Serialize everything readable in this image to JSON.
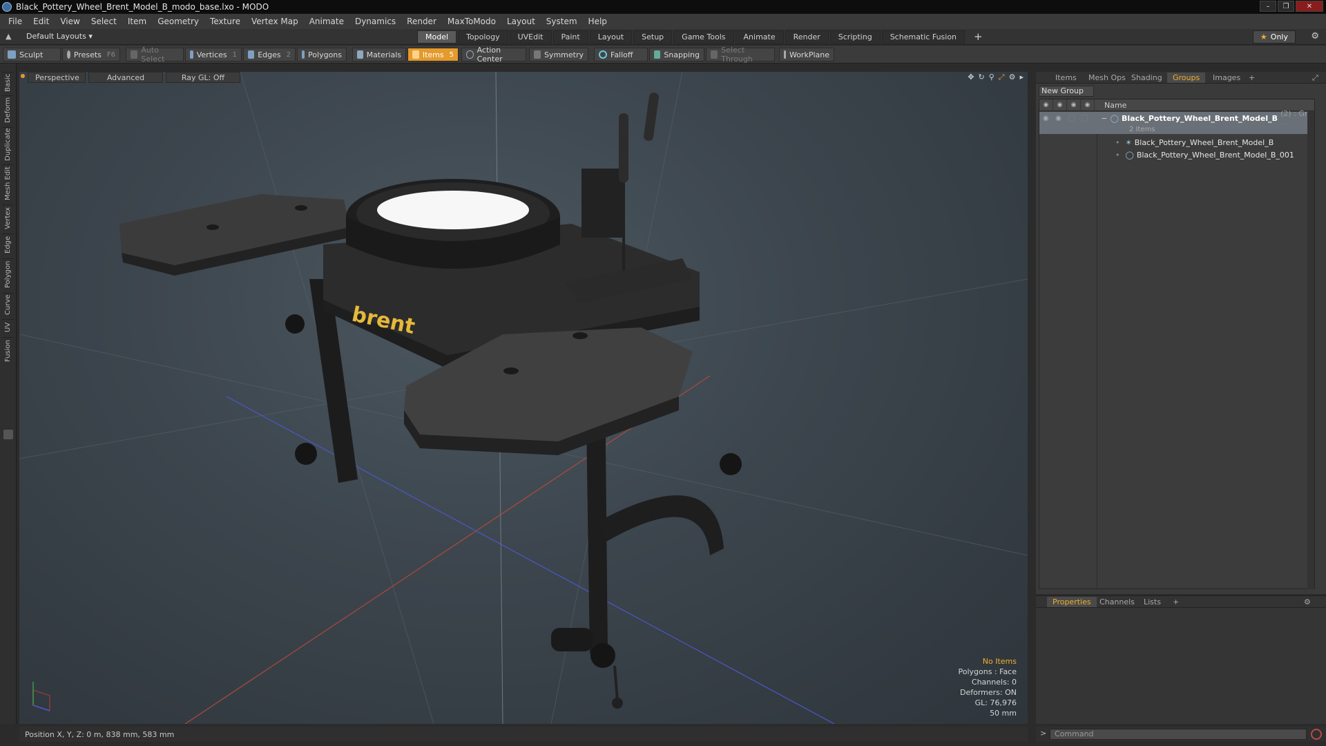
{
  "window": {
    "title": "Black_Pottery_Wheel_Brent_Model_B_modo_base.lxo - MODO"
  },
  "menu": [
    "File",
    "Edit",
    "View",
    "Select",
    "Item",
    "Geometry",
    "Texture",
    "Vertex Map",
    "Animate",
    "Dynamics",
    "Render",
    "MaxToModo",
    "Layout",
    "System",
    "Help"
  ],
  "layoutbar": {
    "layout_dropdown": "Default Layouts",
    "tabs": [
      "Model",
      "Topology",
      "UVEdit",
      "Paint",
      "Layout",
      "Setup",
      "Game Tools",
      "Animate",
      "Render",
      "Scripting",
      "Schematic Fusion"
    ],
    "active_tab": "Model",
    "only_label": "Only"
  },
  "toolbar": {
    "sculpt": "Sculpt",
    "presets": "Presets",
    "presets_key": "F6",
    "auto_select": "Auto Select",
    "vertices": "Vertices",
    "vertices_key": "1",
    "edges": "Edges",
    "edges_key": "2",
    "polygons": "Polygons",
    "materials": "Materials",
    "items": "Items",
    "items_key": "5",
    "action_center": "Action Center",
    "symmetry": "Symmetry",
    "falloff": "Falloff",
    "snapping": "Snapping",
    "select_through": "Select Through",
    "workplane": "WorkPlane"
  },
  "left_tabs": [
    "Basic",
    "Deform",
    "Duplicate",
    "Mesh Edit",
    "Vertex",
    "Edge",
    "Polygon",
    "Curve",
    "UV",
    "Fusion"
  ],
  "viewport": {
    "view_mode": "Perspective",
    "shading": "Advanced",
    "raygl": "Ray GL: Off",
    "logo_text": "brent",
    "info": {
      "no_items": "No Items",
      "polygons": "Polygons : Face",
      "channels": "Channels: 0",
      "deformers": "Deformers: ON",
      "gl": "GL: 76,976",
      "scale": "50 mm"
    }
  },
  "right_panel": {
    "tabs": [
      "Items",
      "Mesh Ops",
      "Shading",
      "Groups",
      "Images"
    ],
    "active_tab": "Groups",
    "new_group": "New Group",
    "column_name": "Name",
    "group": {
      "name": "Black_Pottery_Wheel_Brent_Model_B",
      "extra": "(2) : Gr ...",
      "count": "2 Items",
      "children": [
        "Black_Pottery_Wheel_Brent_Model_B",
        "Black_Pottery_Wheel_Brent_Model_B_001"
      ]
    }
  },
  "props_panel": {
    "tabs": [
      "Properties",
      "Channels",
      "Lists"
    ],
    "active_tab": "Properties"
  },
  "status": {
    "position": "Position X, Y, Z:  0 m, 838 mm, 583 mm"
  },
  "command": {
    "placeholder": "Command"
  },
  "colors": {
    "accent": "#e49a2c",
    "selection_text": "#f0b030"
  }
}
